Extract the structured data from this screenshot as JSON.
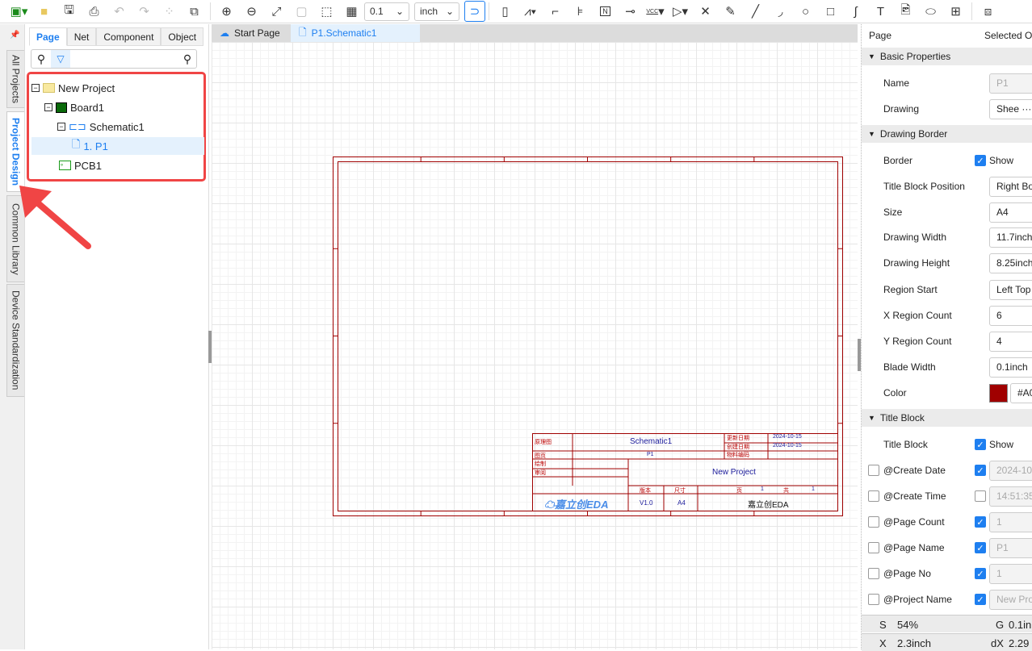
{
  "toolbar": {
    "grid_value": "0.1",
    "unit": "inch",
    "icons": [
      "new-project-icon",
      "open-folder-icon",
      "save-icon",
      "save-as-icon",
      "undo-icon",
      "redo-icon",
      "align-icon",
      "find-icon",
      "zoom-in-icon",
      "zoom-out-icon",
      "fit-icon",
      "zoom-selection-icon",
      "zoom-area-icon",
      "grid-icon"
    ],
    "draw_icons": [
      "component-icon",
      "resistor-icon",
      "wire-icon",
      "bus-icon",
      "net-label-icon",
      "net-flag-icon",
      "junction-icon",
      "vcc-icon",
      "net-port-icon",
      "no-connect-icon",
      "pen-icon",
      "line-icon",
      "arc-icon",
      "circle-icon",
      "rectangle-icon",
      "bezier-icon",
      "text-icon",
      "image-icon",
      "ellipse-icon",
      "table-icon",
      "netlist-icon"
    ],
    "vcc_label": "VCC",
    "net_label": "N"
  },
  "vertical_tabs": [
    "All Projects",
    "Project Design",
    "Common Library",
    "Device Standardization"
  ],
  "left_panel": {
    "tabs": [
      "Page",
      "Net",
      "Component",
      "Object"
    ],
    "search_placeholder": "",
    "tree": [
      {
        "label": "New Project",
        "icon": "folder-icon"
      },
      {
        "label": "Board1",
        "icon": "board-icon"
      },
      {
        "label": "Schematic1",
        "icon": "schematic-icon"
      },
      {
        "label": "1. P1",
        "icon": "page-icon"
      },
      {
        "label": "PCB1",
        "icon": "pcb-icon"
      }
    ]
  },
  "canvas_tabs": [
    "Start Page",
    "P1.Schematic1"
  ],
  "title_block": {
    "labels": {
      "schematic": "原理图",
      "page": "图页",
      "drawn": "绘制",
      "review": "审阅",
      "version": "版本",
      "size": "尺寸",
      "page_no": "页",
      "total": "共",
      "updated": "更新日期",
      "created": "创建日期",
      "material": "物料编码"
    },
    "schematic_name": "Schematic1",
    "page_name": "P1",
    "update_date": "2024-10-15",
    "create_date": "2024-10-15",
    "project": "New Project",
    "version": "V1.0",
    "size": "A4",
    "page_number": "1",
    "page_count": "1",
    "company": "嘉立创EDA",
    "logo_text": "嘉立创EDA"
  },
  "right_panel": {
    "tabs": [
      "Page",
      "Selected O"
    ],
    "sections": {
      "basic": "Basic Properties",
      "border": "Drawing Border",
      "title": "Title Block"
    },
    "basic": [
      {
        "label": "Name",
        "value": "P1",
        "disabled": true
      },
      {
        "label": "Drawing",
        "value": "Shee ···"
      }
    ],
    "border_show_label": "Border",
    "show": "Show",
    "border": [
      {
        "label": "Title Block Position",
        "value": "Right Bo"
      },
      {
        "label": "Size",
        "value": "A4"
      },
      {
        "label": "Drawing Width",
        "value": "11.7inch"
      },
      {
        "label": "Drawing Height",
        "value": "8.25inch"
      },
      {
        "label": "Region Start",
        "value": "Left Top"
      },
      {
        "label": "X Region Count",
        "value": "6"
      },
      {
        "label": "Y Region Count",
        "value": "4"
      },
      {
        "label": "Blade Width",
        "value": "0.1inch"
      }
    ],
    "color_label": "Color",
    "color_value": "#A0",
    "border_color": "#a00000",
    "title_block_label": "Title Block",
    "title_fields": [
      {
        "label": "@Create Date",
        "checked": true,
        "value": "2024-10"
      },
      {
        "label": "@Create Time",
        "checked": false,
        "value": "14:51:35"
      },
      {
        "label": "@Page Count",
        "checked": true,
        "value": "1"
      },
      {
        "label": "@Page Name",
        "checked": true,
        "value": "P1"
      },
      {
        "label": "@Page No",
        "checked": true,
        "value": "1"
      },
      {
        "label": "@Project Name",
        "checked": true,
        "value": "New Pro"
      }
    ],
    "status": {
      "s_label": "S",
      "scale": "54%",
      "g_label": "G",
      "grid": "0.1in",
      "x_label": "X",
      "x": "2.3inch",
      "dx_label": "dX",
      "dx": "2.29"
    }
  },
  "colors": {
    "accent": "#1e7ff0",
    "highlight": "#f04545",
    "border": "#a00000"
  }
}
